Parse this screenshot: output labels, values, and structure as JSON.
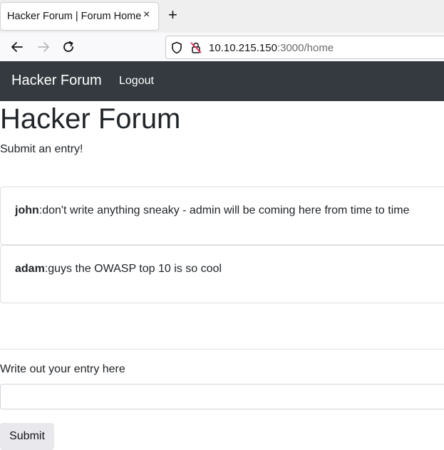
{
  "browser": {
    "tab_title": "Hacker Forum | Forum Home",
    "tab_close": "×",
    "new_tab": "+",
    "url_host": "10.10.215.150",
    "url_rest": ":3000/home"
  },
  "site_nav": {
    "brand": "Hacker Forum",
    "logout": "Logout"
  },
  "main": {
    "title": "Hacker Forum",
    "subtitle": "Submit an entry!",
    "entries": [
      {
        "author": "john",
        "text": ":don't write anything sneaky - admin will be coming here from time to time"
      },
      {
        "author": "adam",
        "text": ":guys the OWASP top 10 is so cool"
      }
    ],
    "form": {
      "label": "Write out your entry here",
      "input_value": "",
      "submit_label": "Submit"
    }
  }
}
